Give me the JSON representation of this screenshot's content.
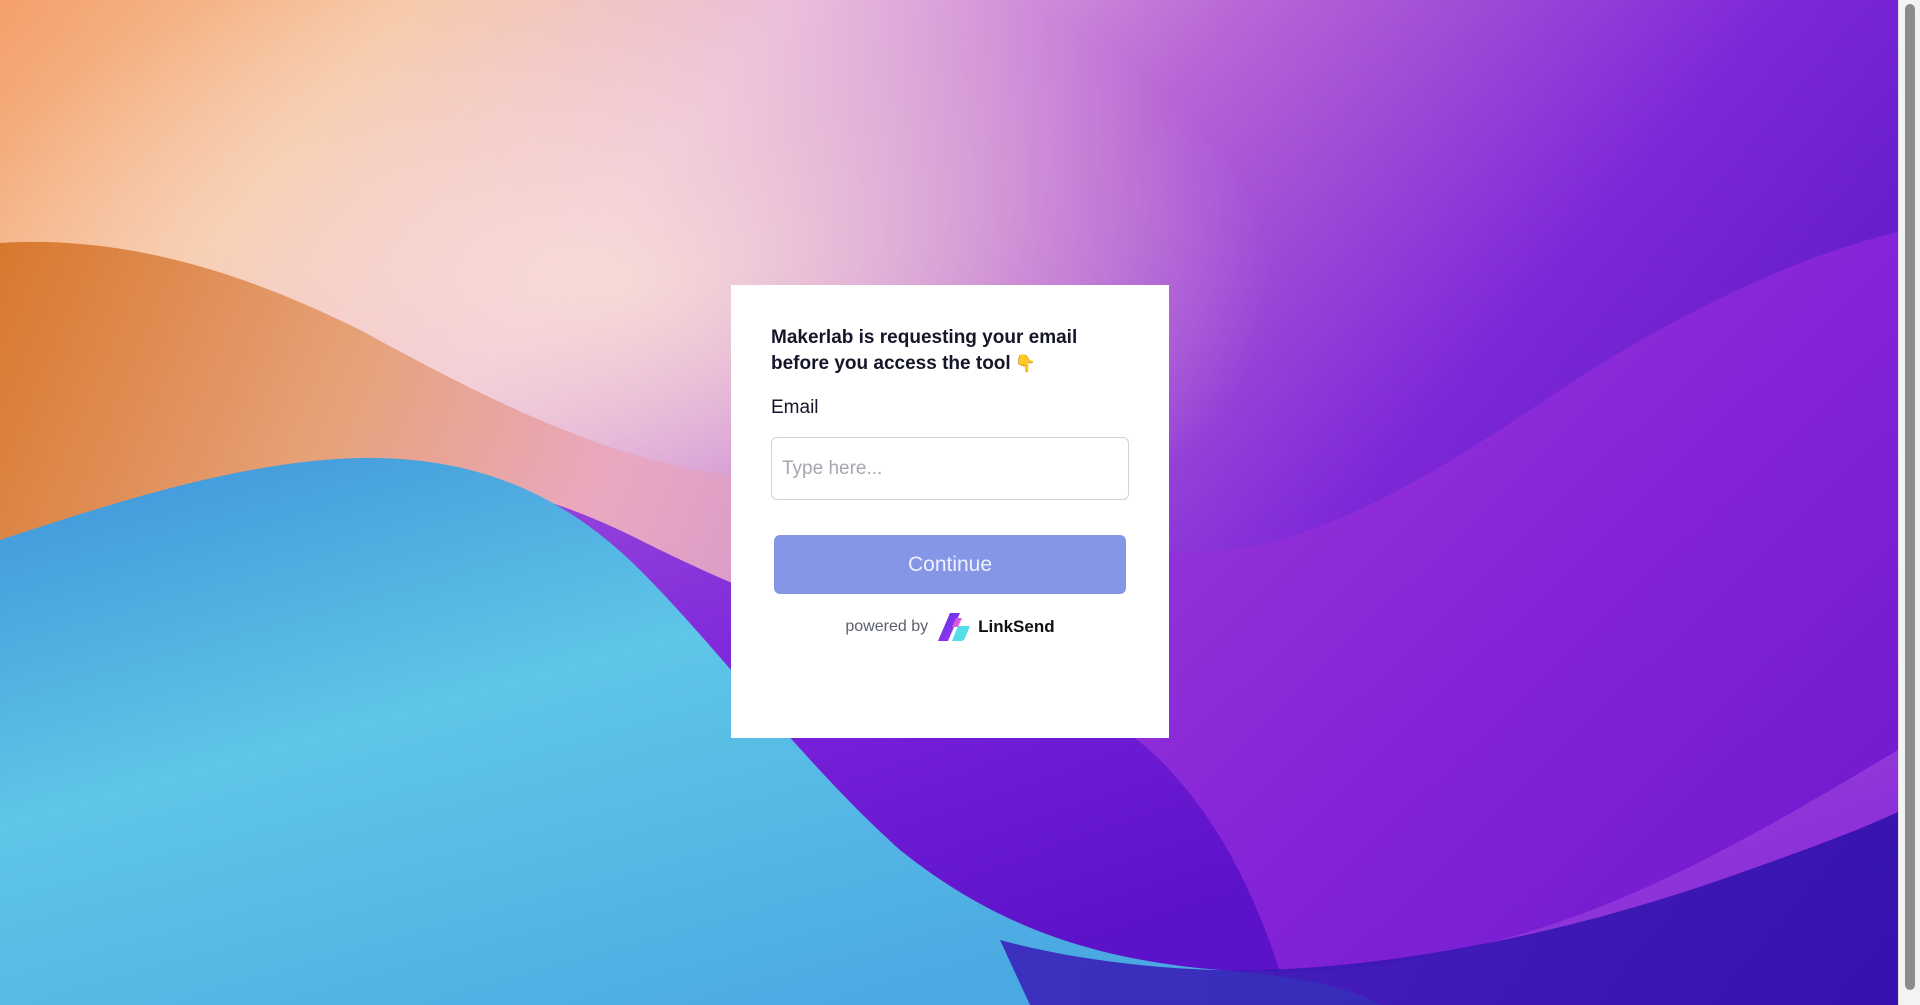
{
  "modal": {
    "title": "Makerlab is requesting your email before you access the tool",
    "title_emoji": "👇",
    "email_label": "Email",
    "email_placeholder": "Type here...",
    "email_value": "",
    "continue_label": "Continue",
    "powered_by": "powered by",
    "brand_name": "LinkSend"
  },
  "colors": {
    "button": "#8696e6",
    "button_text": "#eef0fc",
    "title_text": "#15162a"
  },
  "icons": {
    "brand_logo": "linksend-logo-icon",
    "title_emoji": "pointing-down-emoji"
  }
}
